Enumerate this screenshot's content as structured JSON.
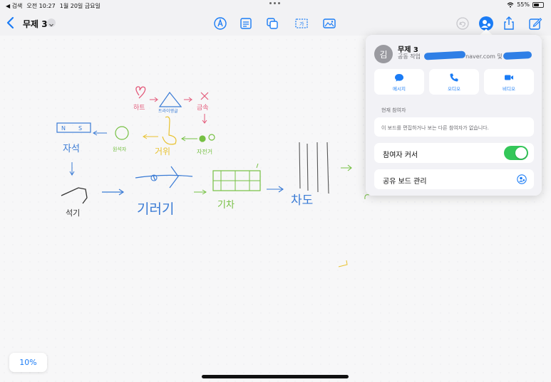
{
  "status_bar": {
    "back_app": "◀ 검색",
    "time": "오전 10:27",
    "date": "1월 20일 금요일",
    "battery": "55%",
    "battery_level": 0.55
  },
  "toolbar": {
    "title": "무제 3",
    "tools": [
      "pen-icon",
      "text-box-icon",
      "shapes-icon",
      "text-icon",
      "media-icon"
    ],
    "right_actions": [
      "undo-icon",
      "collaboration-icon",
      "share-icon",
      "compose-icon"
    ]
  },
  "collab_popover": {
    "avatar_initial": "김",
    "board_title": "무제 3",
    "subtitle_prefix": "공동 작업",
    "subtitle_email_suffix": "naver.com 및",
    "actions": [
      {
        "label": "메시지",
        "icon": "message-icon"
      },
      {
        "label": "오디오",
        "icon": "phone-icon"
      },
      {
        "label": "비디오",
        "icon": "video-icon"
      }
    ],
    "participants_header": "현재 참여자",
    "participants_empty": "이 보드를 편집하거나 보는 다른 참여자가 없습니다.",
    "cursor_label": "참여자 커서",
    "cursor_enabled": true,
    "manage_label": "공유 보드 관리"
  },
  "canvas": {
    "sketch_labels": [
      "하트",
      "트라이앵글",
      "금속",
      "자석",
      "원석자",
      "거위",
      "자전거",
      "석기",
      "기러기",
      "기차",
      "차도"
    ]
  },
  "zoom": {
    "level": "10%"
  },
  "colors": {
    "accent": "#1b7cf5",
    "toggle_on": "#34c759",
    "redaction": "#2f7fe6"
  }
}
